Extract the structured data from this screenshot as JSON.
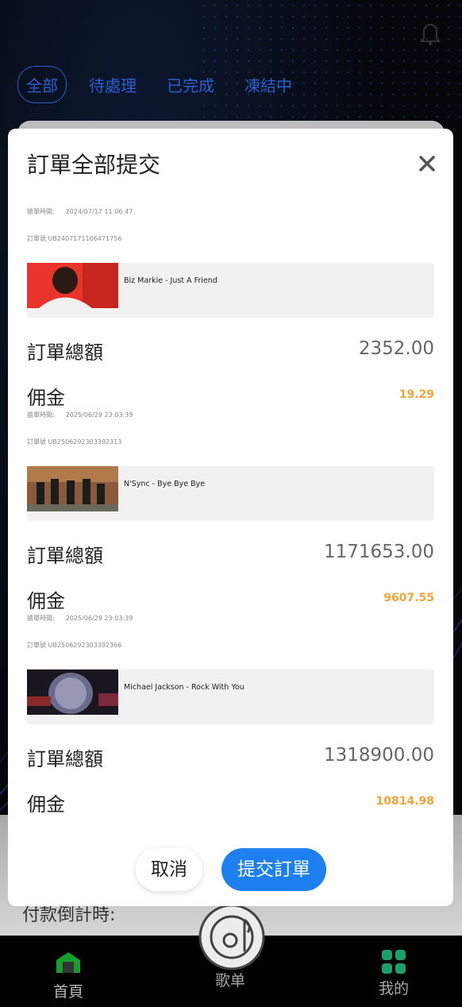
{
  "background": {
    "filter_tabs": [
      "全部",
      "待處理",
      "已完成",
      "凍結中"
    ],
    "countdown_label": "付款倒計時:"
  },
  "modal": {
    "title": "訂單全部提交",
    "orders": [
      {
        "time_label": "搶單時間:",
        "time": "2024/07/17 11:06:47",
        "order_no": "訂單號 UB2407171106471756",
        "song": "Biz Markie - Just A Friend",
        "total_label": "訂單總額",
        "total": "2352.00",
        "commission_label": "佣金",
        "commission": "19.29"
      },
      {
        "time_label": "搶單時間:",
        "time": "2025/06/29 23:03:39",
        "order_no": "訂單號 UB2506292303392313",
        "song": "N'Sync - Bye Bye Bye",
        "total_label": "訂單總額",
        "total": "1171653.00",
        "commission_label": "佣金",
        "commission": "9607.55"
      },
      {
        "time_label": "搶單時間:",
        "time": "2025/06/29 23:03:39",
        "order_no": "訂單號 UB2506292303392366",
        "song": "Michael Jackson - Rock With You",
        "total_label": "訂單總額",
        "total": "1318900.00",
        "commission_label": "佣金",
        "commission": "10814.98"
      }
    ],
    "cancel_label": "取消",
    "submit_label": "提交訂單"
  },
  "nav": {
    "home": "首頁",
    "songs": "歌单",
    "mine": "我的"
  },
  "colors": {
    "accent": "#1e7ff0",
    "commission": "#f5a334",
    "tab_blue": "#2a5fd0",
    "nav_green": "#1aa06a"
  }
}
